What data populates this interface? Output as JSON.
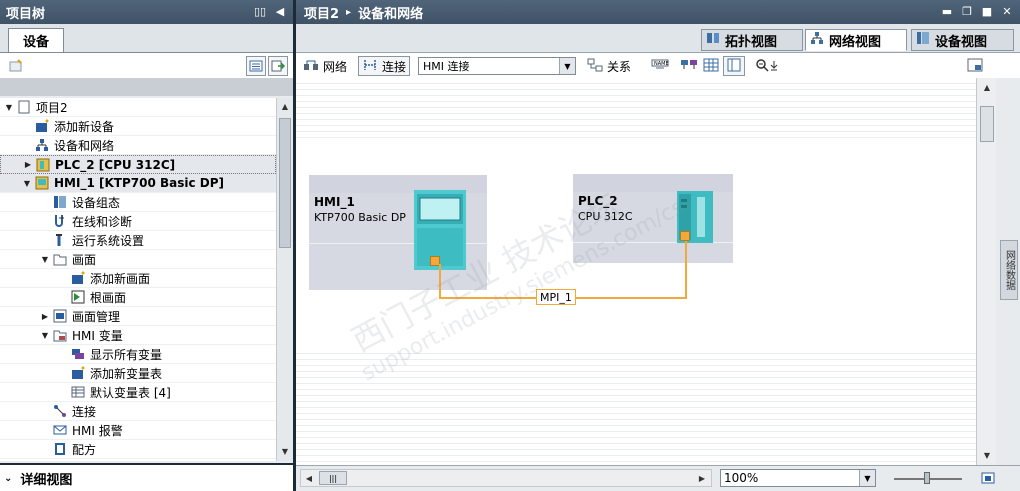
{
  "left": {
    "title": "项目树",
    "tab": "设备",
    "tree": [
      {
        "label": "项目2",
        "indent": 0,
        "toggle": "open",
        "icon": "project-icon",
        "bold": false
      },
      {
        "label": "添加新设备",
        "indent": 1,
        "toggle": "",
        "icon": "add-device-icon",
        "bold": false
      },
      {
        "label": "设备和网络",
        "indent": 1,
        "toggle": "",
        "icon": "network-icon",
        "bold": false
      },
      {
        "label": "PLC_2 [CPU 312C]",
        "indent": 1,
        "toggle": "closed",
        "icon": "plc-icon",
        "bold": true
      },
      {
        "label": "HMI_1 [KTP700 Basic DP]",
        "indent": 1,
        "toggle": "open",
        "icon": "hmi-icon",
        "bold": true
      },
      {
        "label": "设备组态",
        "indent": 2,
        "toggle": "",
        "icon": "device-config-icon",
        "bold": false
      },
      {
        "label": "在线和诊断",
        "indent": 2,
        "toggle": "",
        "icon": "online-diagnostics-icon",
        "bold": false
      },
      {
        "label": "运行系统设置",
        "indent": 2,
        "toggle": "",
        "icon": "runtime-settings-icon",
        "bold": false
      },
      {
        "label": "画面",
        "indent": 2,
        "toggle": "open",
        "icon": "folder-icon",
        "bold": false
      },
      {
        "label": "添加新画面",
        "indent": 3,
        "toggle": "",
        "icon": "add-screen-icon",
        "bold": false
      },
      {
        "label": "根画面",
        "indent": 3,
        "toggle": "",
        "icon": "screen-icon",
        "bold": false
      },
      {
        "label": "画面管理",
        "indent": 2,
        "toggle": "closed",
        "icon": "screen-management-icon",
        "bold": false
      },
      {
        "label": "HMI 变量",
        "indent": 2,
        "toggle": "open",
        "icon": "hmi-tags-folder-icon",
        "bold": false
      },
      {
        "label": "显示所有变量",
        "indent": 3,
        "toggle": "",
        "icon": "show-tags-icon",
        "bold": false
      },
      {
        "label": "添加新变量表",
        "indent": 3,
        "toggle": "",
        "icon": "add-tag-table-icon",
        "bold": false
      },
      {
        "label": "默认变量表 [4]",
        "indent": 3,
        "toggle": "",
        "icon": "tag-table-icon",
        "bold": false
      },
      {
        "label": "连接",
        "indent": 2,
        "toggle": "",
        "icon": "connection-icon",
        "bold": false
      },
      {
        "label": "HMI 报警",
        "indent": 2,
        "toggle": "",
        "icon": "alarm-icon",
        "bold": false
      },
      {
        "label": "配方",
        "indent": 2,
        "toggle": "",
        "icon": "recipe-icon",
        "bold": false
      }
    ],
    "detail_title": "详细视图"
  },
  "editor": {
    "breadcrumb_root": "项目2",
    "breadcrumb_sep": "▸",
    "breadcrumb_page": "设备和网络",
    "view_tabs": [
      "拓扑视图",
      "网络视图",
      "设备视图"
    ],
    "toolbar": {
      "network": "网络",
      "connect": "连接",
      "connection_type": "HMI 连接",
      "relations": "关系"
    },
    "devices": [
      {
        "name": "HMI_1",
        "type": "KTP700 Basic DP"
      },
      {
        "name": "PLC_2",
        "type": "CPU 312C"
      }
    ],
    "network_label": "MPI_1",
    "zoom": "100%",
    "side_tab": "网络数据",
    "watermark1": "西门子工业  技术论坛",
    "watermark2": "support.industry.siemens.com/cs"
  }
}
